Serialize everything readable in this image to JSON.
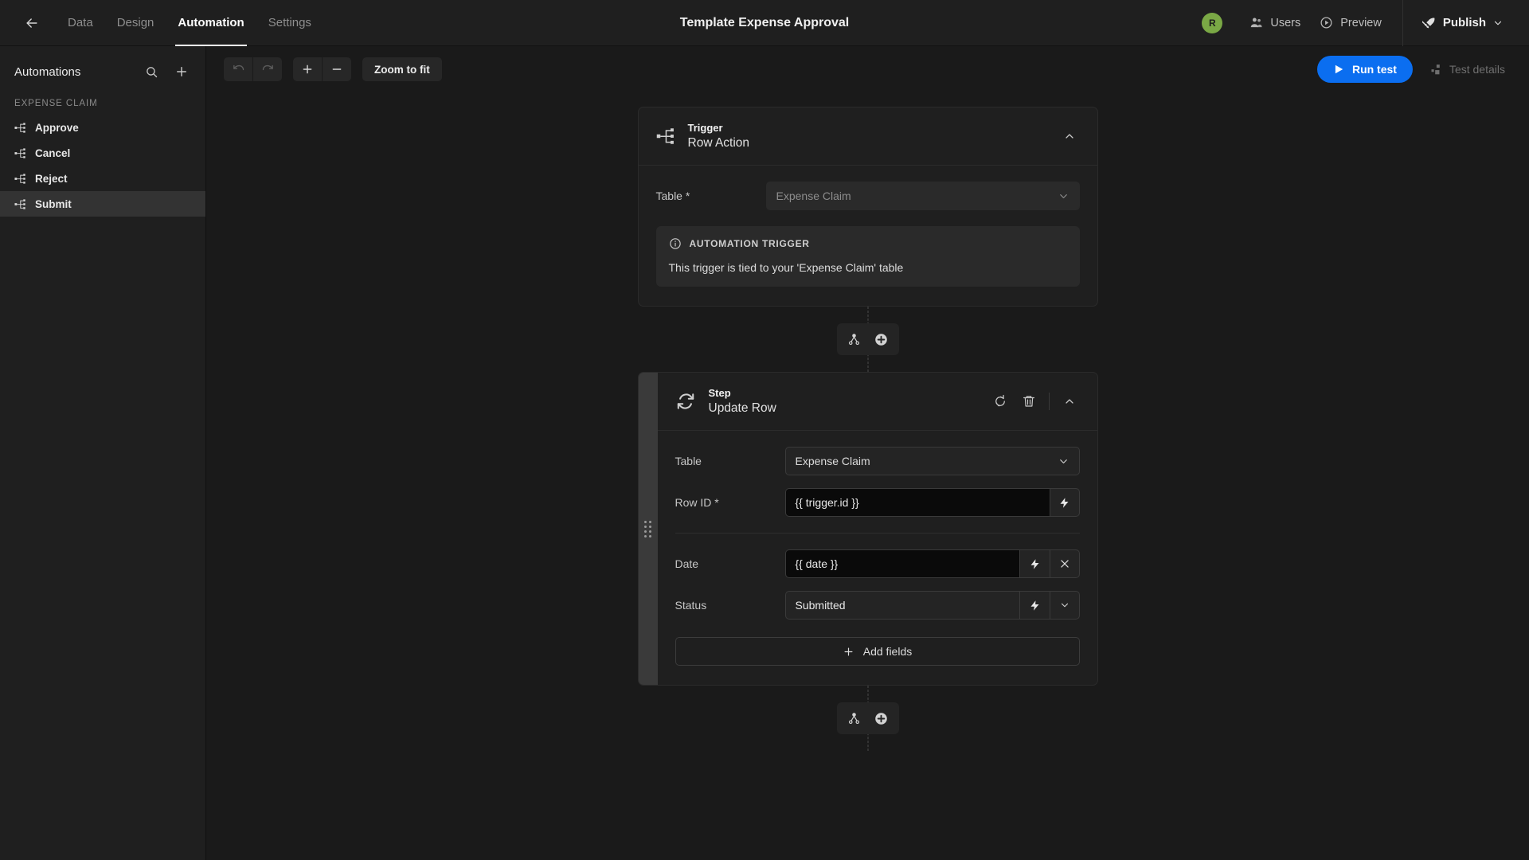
{
  "topbar": {
    "back_icon": "arrow-left-icon",
    "tabs": [
      {
        "label": "Data",
        "active": false
      },
      {
        "label": "Design",
        "active": false
      },
      {
        "label": "Automation",
        "active": true
      },
      {
        "label": "Settings",
        "active": false
      }
    ],
    "app_title": "Template Expense Approval",
    "avatar_initial": "R",
    "avatar_color": "#7aa845",
    "users_label": "Users",
    "preview_label": "Preview",
    "publish_label": "Publish"
  },
  "sidebar": {
    "title": "Automations",
    "search_icon": "search-icon",
    "add_icon": "plus-icon",
    "group_label": "EXPENSE CLAIM",
    "items": [
      {
        "label": "Approve",
        "selected": false
      },
      {
        "label": "Cancel",
        "selected": false
      },
      {
        "label": "Reject",
        "selected": false
      },
      {
        "label": "Submit",
        "selected": true
      }
    ]
  },
  "toolbar": {
    "undo_icon": "undo-icon",
    "redo_icon": "redo-icon",
    "zoom_in_label": "+",
    "zoom_out_label": "−",
    "zoom_to_fit_label": "Zoom to fit",
    "run_test_label": "Run test",
    "test_details_label": "Test details"
  },
  "flow": {
    "trigger": {
      "kind": "Trigger",
      "name": "Row Action",
      "collapse_icon": "chevron-up-icon",
      "fields": [
        {
          "label": "Table *",
          "value": "Expense Claim",
          "type": "select-disabled"
        }
      ],
      "info": {
        "heading": "AUTOMATION TRIGGER",
        "icon": "info-icon",
        "text": "This trigger is tied to your 'Expense Claim' table"
      }
    },
    "connector": {
      "branch_icon": "branch-icon",
      "add_icon": "plus-circle-icon"
    },
    "step": {
      "kind": "Step",
      "name": "Update Row",
      "icon": "sync-icon",
      "rerun_icon": "rerun-icon",
      "delete_icon": "trash-icon",
      "collapse_icon": "chevron-up-icon",
      "fields": [
        {
          "label": "Table",
          "value": "Expense Claim",
          "type": "select"
        },
        {
          "label": "Row ID *",
          "value": "{{ trigger.id }}",
          "type": "binding"
        },
        {
          "label": "Date",
          "value": "{{ date }}",
          "type": "binding-clear"
        },
        {
          "label": "Status",
          "value": "Submitted",
          "type": "binding-select"
        }
      ],
      "add_fields_label": "Add fields"
    },
    "connector2": {
      "branch_icon": "branch-icon",
      "add_icon": "plus-circle-icon"
    }
  }
}
